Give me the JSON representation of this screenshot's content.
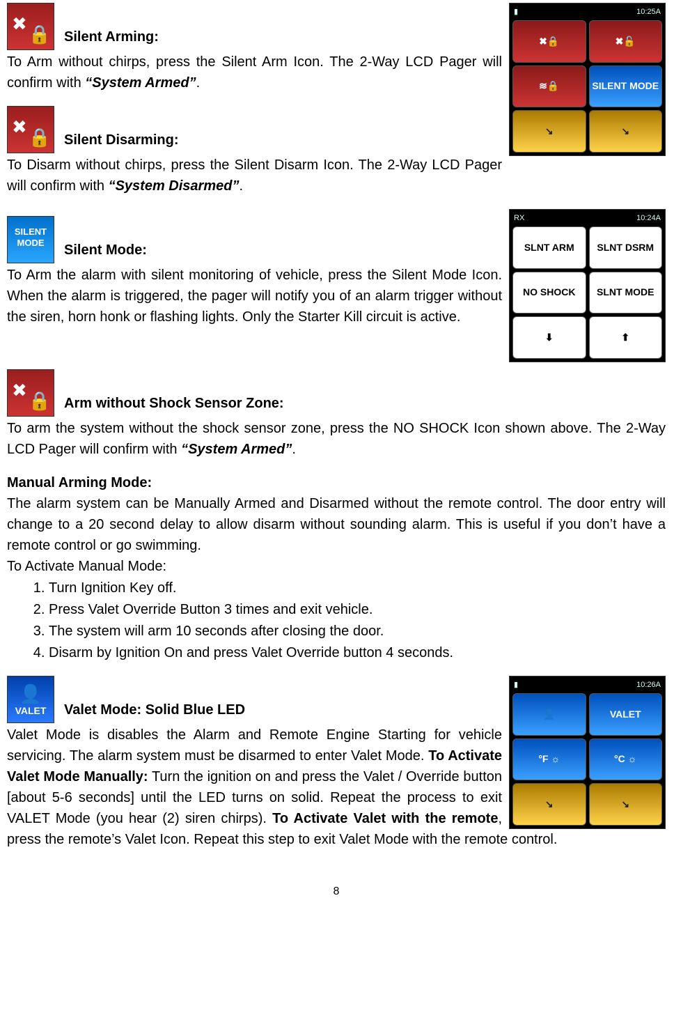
{
  "sections": {
    "silent_arming": {
      "heading": "Silent Arming:",
      "body_pre": "To Arm without chirps, press the Silent Arm Icon. The 2-Way LCD Pager will confirm with ",
      "body_em": "“System Armed”",
      "body_post": "."
    },
    "silent_disarming": {
      "heading": "Silent Disarming:",
      "body_pre": "To Disarm without chirps, press the Silent Disarm Icon. The 2-Way LCD Pager will confirm with ",
      "body_em": "“System Disarmed”",
      "body_post": "."
    },
    "silent_mode": {
      "heading": "Silent Mode:",
      "body": "To Arm the alarm with silent monitoring of vehicle, press the Silent Mode Icon. When the alarm is triggered, the pager will notify you of an alarm trigger without the siren, horn honk or flashing lights. Only the Starter Kill circuit is active."
    },
    "arm_no_shock": {
      "heading": "Arm without Shock Sensor Zone:",
      "body_pre": "To arm the system without the shock sensor zone, press the NO SHOCK Icon shown above. The 2-Way LCD Pager will confirm with ",
      "body_em": "“System Armed”",
      "body_post": "."
    },
    "manual_arming": {
      "heading": "Manual Arming Mode:",
      "intro": "The alarm system can be Manually Armed and Disarmed without the remote control. The door entry will change to a 20 second delay to allow disarm without sounding alarm. This is useful if you don’t have a remote control or go swimming.",
      "activate_label": "To Activate Manual Mode:",
      "steps": [
        "Turn Ignition Key off.",
        "Press Valet Override Button 3 times and exit vehicle.",
        "The system will arm 10 seconds after closing the door.",
        "Disarm by Ignition On and press Valet Override button 4 seconds."
      ]
    },
    "valet_mode": {
      "heading": "Valet Mode: Solid Blue LED",
      "body_1": "Valet Mode is disables the Alarm and Remote Engine Starting for vehicle servicing. The alarm system must be disarmed to enter Valet Mode. ",
      "body_b1": "To Activate Valet Mode Manually:",
      "body_2": " Turn the ignition on and press the Valet / Override button [about 5-6 seconds] until the LED turns on solid. Repeat the process to exit VALET Mode (you hear (2) siren chirps). ",
      "body_b2": "To Activate Valet with the remote",
      "body_3": ", press the remote’s Valet Icon. Repeat this step to exit Valet Mode with the remote control."
    }
  },
  "pagers": {
    "p1": {
      "time": "10:25A",
      "cells": [
        "✖🔒",
        "✖🔓",
        "≋🔒",
        "SILENT MODE",
        "↘",
        "↘"
      ]
    },
    "p2": {
      "rx": "RX",
      "time": "10:24A",
      "cells": [
        "SLNT ARM",
        "SLNT DSRM",
        "NO SHOCK",
        "SLNT MODE",
        "⬇",
        "⬆"
      ]
    },
    "p3": {
      "time": "10:26A",
      "cells": [
        "👤",
        "VALET",
        "°F ☼",
        "°C ☼",
        "↘",
        "↘"
      ]
    }
  },
  "page_number": "8"
}
